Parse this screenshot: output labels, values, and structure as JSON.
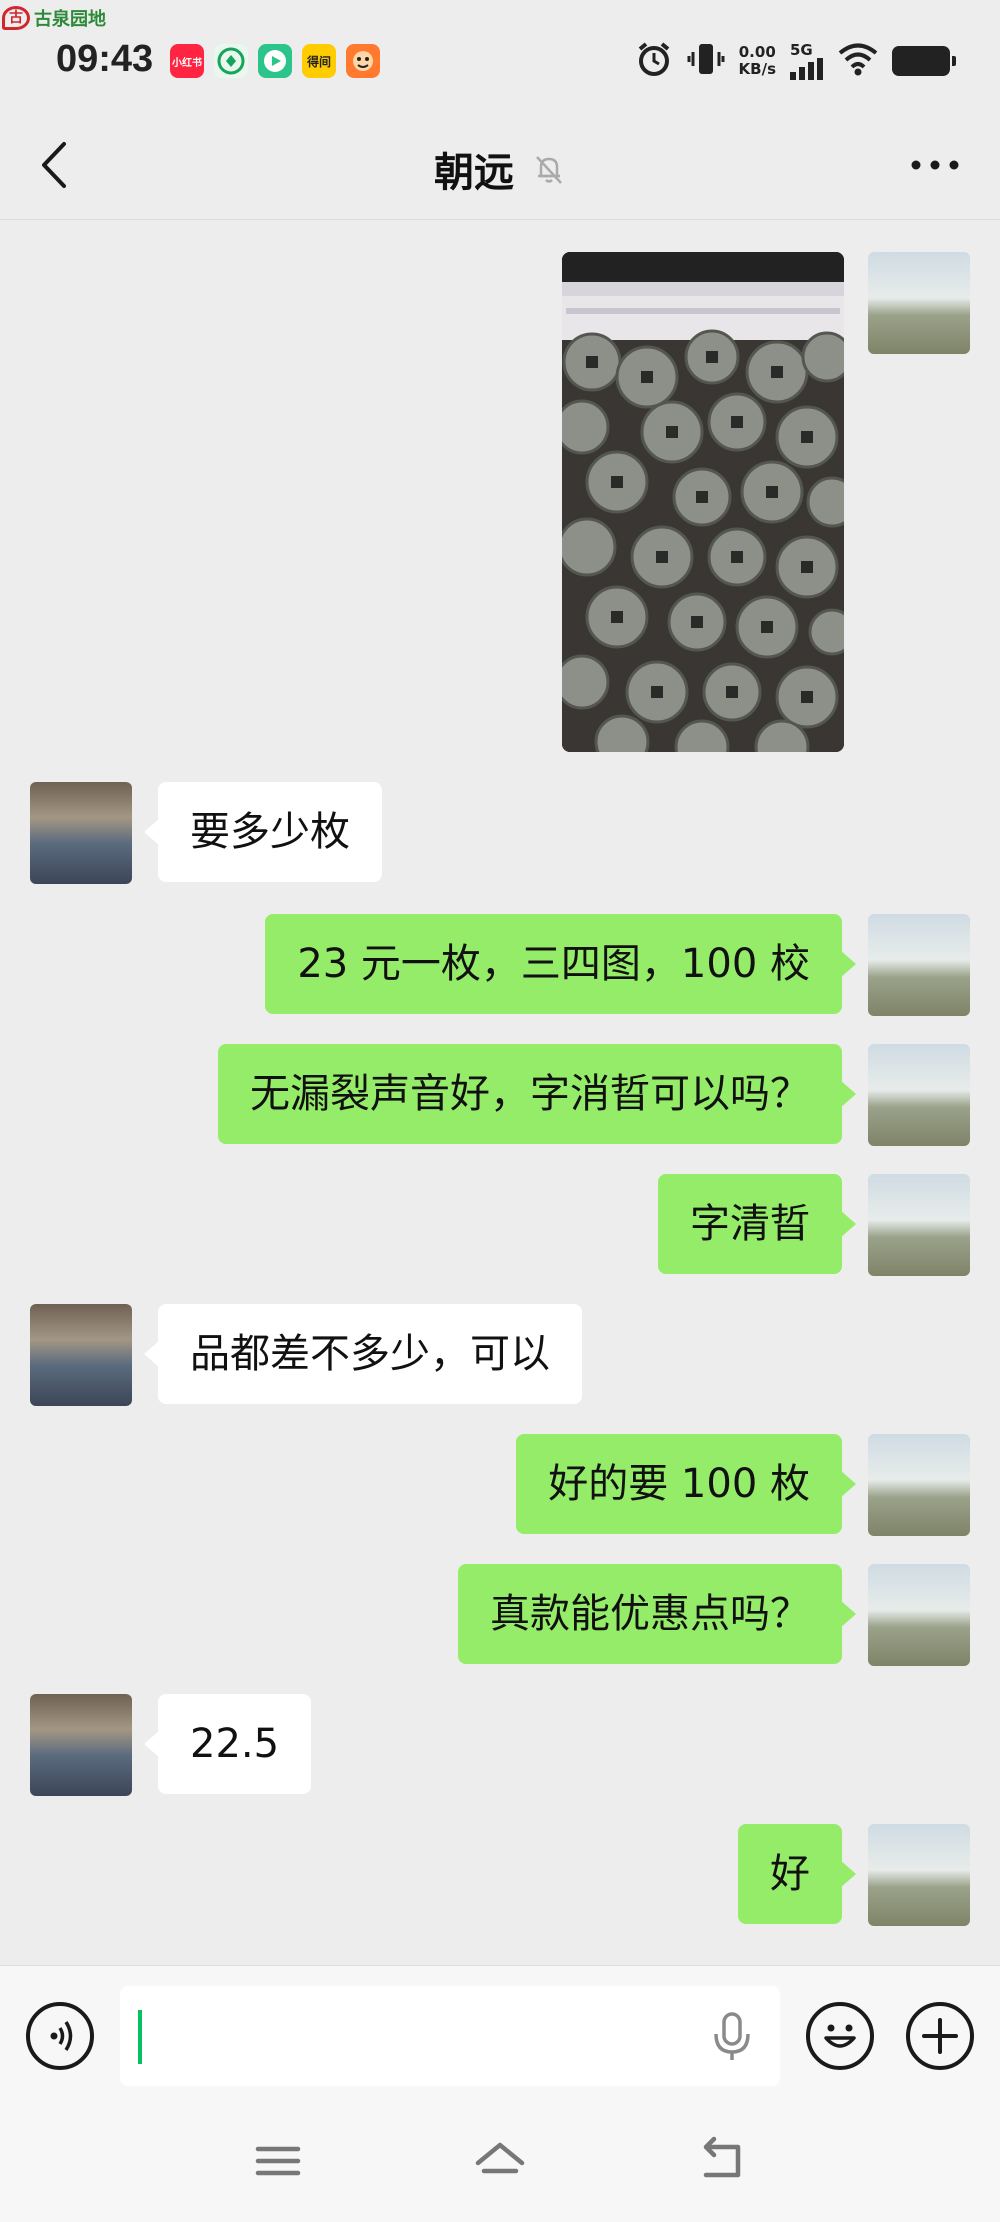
{
  "watermark": {
    "logo_char": "古",
    "text": "古泉园地"
  },
  "status_bar": {
    "time": "09:43",
    "app_icons": [
      {
        "name": "xiaohongshu-icon",
        "label": "小红书",
        "color": "#ff2442"
      },
      {
        "name": "bank-app-icon",
        "label": "",
        "color": "#16a35a"
      },
      {
        "name": "video-app-icon",
        "label": "",
        "color": "#2bc48a"
      },
      {
        "name": "dewu-app-icon",
        "label": "得间",
        "color": "#ffcc00"
      },
      {
        "name": "game-app-icon",
        "label": "",
        "color": "#ff7a2f"
      }
    ],
    "net_speed_value": "0.00",
    "net_speed_unit": "KB/s",
    "network": "5G"
  },
  "header": {
    "title": "朝远"
  },
  "messages": [
    {
      "id": "m0",
      "type": "image",
      "direction": "out",
      "alt": "古钱币照片"
    },
    {
      "id": "m1",
      "direction": "in",
      "text": "要多少枚"
    },
    {
      "id": "m2",
      "direction": "out",
      "text": "23 元一枚，三四图，100 校"
    },
    {
      "id": "m3",
      "direction": "out",
      "text": "无漏裂声音好，字消晢可以吗？"
    },
    {
      "id": "m4",
      "direction": "out",
      "text": "字清晢"
    },
    {
      "id": "m5",
      "direction": "in",
      "text": "品都差不多少，可以"
    },
    {
      "id": "m6",
      "direction": "out",
      "text": "好的要 100 枚"
    },
    {
      "id": "m7",
      "direction": "out",
      "text": "真款能优惠点吗？"
    },
    {
      "id": "m8",
      "direction": "in",
      "text": "22.5"
    },
    {
      "id": "m9",
      "direction": "out",
      "text": "好"
    }
  ],
  "input": {
    "value": "",
    "placeholder": ""
  },
  "colors": {
    "background": "#ededed",
    "out_bubble": "#95ec69",
    "in_bubble": "#ffffff",
    "caret": "#07c160"
  }
}
